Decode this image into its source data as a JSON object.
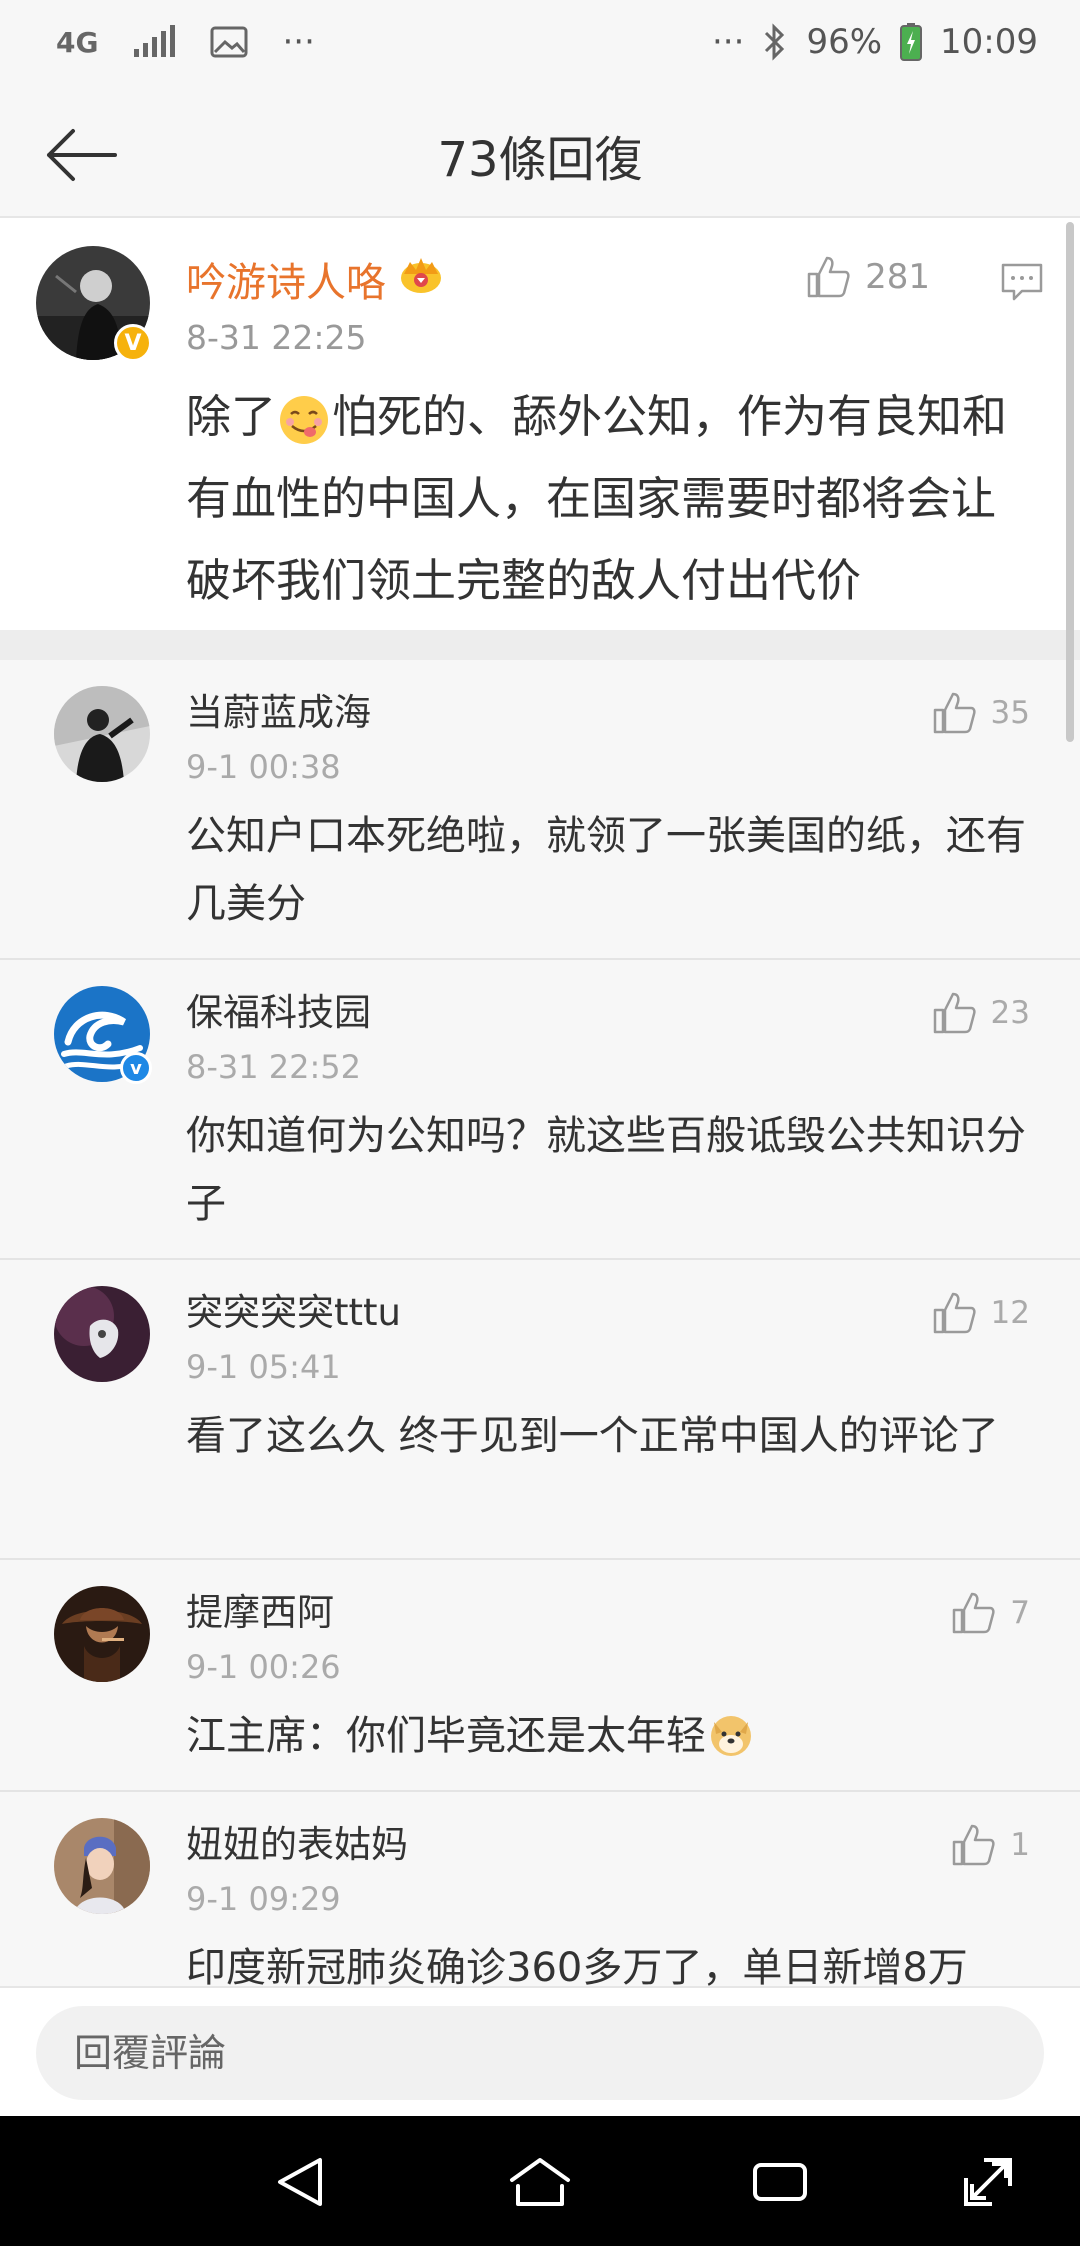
{
  "status_bar": {
    "network": "4G",
    "more": "···",
    "more_right": "···",
    "battery": "96%",
    "time": "10:09"
  },
  "header": {
    "title": "73條回復"
  },
  "main_comment": {
    "username": "吟游诗人咯",
    "time": "8-31 22:25",
    "likes": "281",
    "text_before_emoji": "除了",
    "text_after_emoji": "怕死的、舔外公知，作为有良知和有血性的中国人，在国家需要时都将会让破坏我们领土完整的敌人付出代价"
  },
  "replies": [
    {
      "username": "当蔚蓝成海",
      "time": "9-1 00:38",
      "likes": "35",
      "text": "公知户口本死绝啦，就领了一张美国的纸，还有几美分"
    },
    {
      "username": "保福科技园",
      "time": "8-31 22:52",
      "likes": "23",
      "text": "你知道何为公知吗？就这些百般诋毁公共知识分子"
    },
    {
      "username": "突突突突tttu",
      "time": "9-1 05:41",
      "likes": "12",
      "text": "看了这么久 终于见到一个正常中国人的评论了"
    },
    {
      "username": "提摩西阿",
      "time": "9-1 00:26",
      "likes": "7",
      "text": "江主席：你们毕竟还是太年轻"
    },
    {
      "username": "妞妞的表姑妈",
      "time": "9-1 09:29",
      "likes": "1",
      "text": "印度新冠肺炎确诊360多万了，单日新增8万"
    }
  ],
  "bottom": {
    "reply_placeholder": "回覆評論"
  },
  "colors": {
    "accent_orange": "#e8742c",
    "text_primary": "#333333",
    "text_secondary": "#999999",
    "background": "#f7f7f7"
  }
}
